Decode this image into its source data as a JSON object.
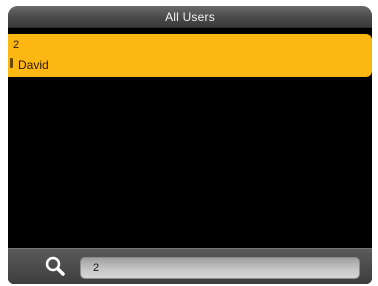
{
  "header": {
    "title": "All Users"
  },
  "users": [
    {
      "id": "2",
      "name": "David",
      "selected": true
    }
  ],
  "search": {
    "icon": "magnifier-icon",
    "value": "2"
  },
  "colors": {
    "selected_row": "#fdb712",
    "background": "#000000",
    "title_bar": "#4a4a4a"
  }
}
